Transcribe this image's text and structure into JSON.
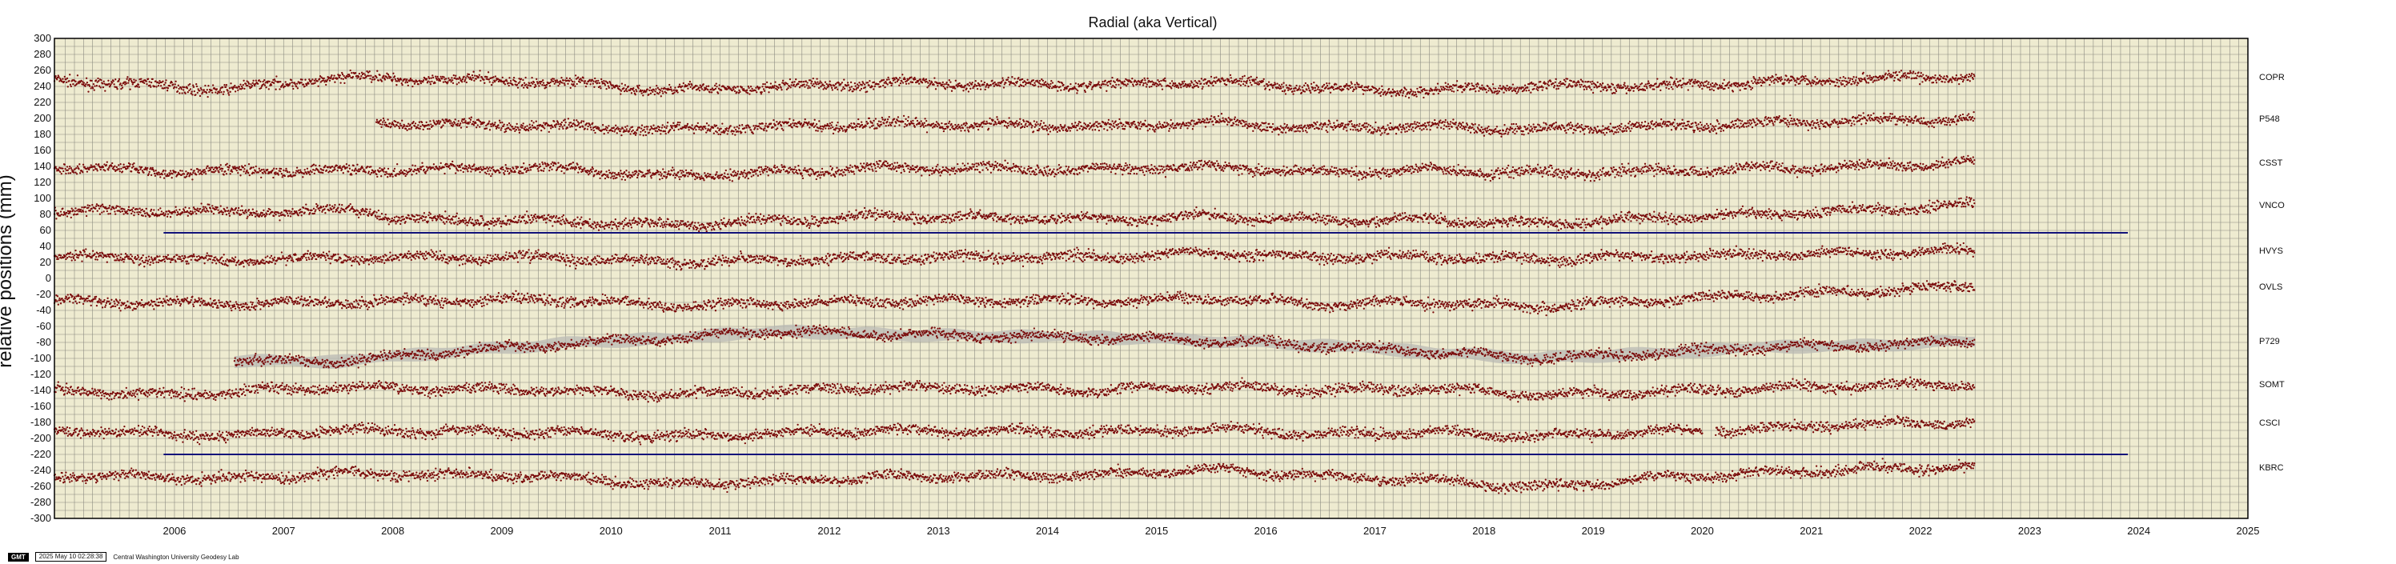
{
  "colors": {
    "background": "#eeebd0",
    "grid": "#8a8a80",
    "points": "#7a0b0b",
    "error_band": "#b9b9b4",
    "highlight_line": "#12137a"
  },
  "footer": {
    "logo": "GMT",
    "timestamp": "2025 May 10 02:28:38",
    "credit": "Central Washington University Geodesy Lab"
  },
  "chart_data": {
    "type": "scatter",
    "title": "Radial (aka Vertical)",
    "xlabel": "",
    "ylabel": "relative positions (mm)",
    "xlim": [
      2005.4,
      2025.5
    ],
    "ylim": [
      -300,
      300
    ],
    "grid": true,
    "x_ticks": [
      "2006",
      "2007",
      "2008",
      "2009",
      "2010",
      "2011",
      "2012",
      "2013",
      "2014",
      "2015",
      "2016",
      "2017",
      "2018",
      "2019",
      "2020",
      "2021",
      "2022",
      "2023",
      "2024",
      "2025"
    ],
    "y_ticks": [
      300,
      280,
      260,
      240,
      220,
      200,
      180,
      160,
      140,
      120,
      100,
      80,
      60,
      40,
      20,
      0,
      -20,
      -40,
      -60,
      -80,
      -100,
      -120,
      -140,
      -160,
      -180,
      -200,
      -220,
      -240,
      -260,
      -280,
      -300
    ],
    "series": [
      {
        "name": "COPR",
        "start": 2005.4,
        "end": 2023.0,
        "trend": [
          [
            2005.4,
            248
          ],
          [
            2007.0,
            236
          ],
          [
            2008.0,
            251
          ],
          [
            2010.0,
            246
          ],
          [
            2011.0,
            235
          ],
          [
            2013.0,
            244
          ],
          [
            2015.0,
            242
          ],
          [
            2016.0,
            246
          ],
          [
            2017.0,
            238
          ],
          [
            2018.0,
            234
          ],
          [
            2019.0,
            241
          ],
          [
            2020.0,
            240
          ],
          [
            2021.0,
            245
          ],
          [
            2022.0,
            250
          ],
          [
            2023.0,
            252
          ]
        ]
      },
      {
        "name": "P548",
        "start": 2008.35,
        "end": 2023.0,
        "trend": [
          [
            2008.35,
            195
          ],
          [
            2010.0,
            190
          ],
          [
            2011.0,
            186
          ],
          [
            2013.0,
            193
          ],
          [
            2015.0,
            190
          ],
          [
            2016.0,
            195
          ],
          [
            2017.0,
            188
          ],
          [
            2018.0,
            190
          ],
          [
            2019.0,
            186
          ],
          [
            2020.0,
            190
          ],
          [
            2021.0,
            194
          ],
          [
            2022.0,
            197
          ],
          [
            2023.0,
            200
          ]
        ]
      },
      {
        "name": "CSST",
        "start": 2005.4,
        "end": 2023.0,
        "trend": [
          [
            2005.4,
            140
          ],
          [
            2006.5,
            133
          ],
          [
            2008.0,
            135
          ],
          [
            2010.0,
            138
          ],
          [
            2011.0,
            128
          ],
          [
            2013.0,
            138
          ],
          [
            2015.0,
            136
          ],
          [
            2016.0,
            140
          ],
          [
            2017.0,
            132
          ],
          [
            2018.0,
            135
          ],
          [
            2019.0,
            132
          ],
          [
            2020.0,
            134
          ],
          [
            2021.0,
            137
          ],
          [
            2022.0,
            140
          ],
          [
            2023.0,
            145
          ]
        ]
      },
      {
        "name": "VNCO",
        "start": 2005.4,
        "end": 2023.0,
        "trend": [
          [
            2005.4,
            85
          ],
          [
            2007.0,
            83
          ],
          [
            2008.3,
            85
          ],
          [
            2008.5,
            74
          ],
          [
            2010.0,
            72
          ],
          [
            2011.0,
            66
          ],
          [
            2013.0,
            78
          ],
          [
            2015.0,
            74
          ],
          [
            2016.0,
            78
          ],
          [
            2017.0,
            72
          ],
          [
            2018.0,
            74
          ],
          [
            2019.0,
            68
          ],
          [
            2020.0,
            75
          ],
          [
            2021.0,
            80
          ],
          [
            2022.0,
            85
          ],
          [
            2023.0,
            92
          ]
        ]
      },
      {
        "name": "HVYS",
        "start": 2005.4,
        "end": 2023.0,
        "trend": [
          [
            2005.4,
            28
          ],
          [
            2007.0,
            22
          ],
          [
            2008.0,
            26
          ],
          [
            2010.0,
            26
          ],
          [
            2011.0,
            20
          ],
          [
            2013.0,
            26
          ],
          [
            2015.0,
            27
          ],
          [
            2016.0,
            32
          ],
          [
            2017.0,
            26
          ],
          [
            2018.0,
            27
          ],
          [
            2019.0,
            24
          ],
          [
            2020.0,
            27
          ],
          [
            2021.0,
            30
          ],
          [
            2022.0,
            32
          ],
          [
            2023.0,
            35
          ]
        ]
      },
      {
        "name": "OVLS",
        "start": 2005.4,
        "end": 2023.0,
        "trend": [
          [
            2005.4,
            -28
          ],
          [
            2007.0,
            -32
          ],
          [
            2008.0,
            -30
          ],
          [
            2010.0,
            -26
          ],
          [
            2011.0,
            -34
          ],
          [
            2013.0,
            -28
          ],
          [
            2015.0,
            -28
          ],
          [
            2016.0,
            -25
          ],
          [
            2017.0,
            -32
          ],
          [
            2018.0,
            -30
          ],
          [
            2019.0,
            -36
          ],
          [
            2020.0,
            -28
          ],
          [
            2021.0,
            -22
          ],
          [
            2022.0,
            -16
          ],
          [
            2023.0,
            -10
          ]
        ]
      },
      {
        "name": "P729",
        "start": 2007.05,
        "end": 2023.0,
        "band": 7,
        "trend": [
          [
            2007.05,
            -103
          ],
          [
            2008.0,
            -104
          ],
          [
            2009.0,
            -92
          ],
          [
            2010.0,
            -82
          ],
          [
            2011.0,
            -75
          ],
          [
            2012.0,
            -66
          ],
          [
            2013.0,
            -70
          ],
          [
            2014.0,
            -72
          ],
          [
            2015.0,
            -74
          ],
          [
            2016.0,
            -78
          ],
          [
            2017.0,
            -84
          ],
          [
            2018.0,
            -92
          ],
          [
            2019.0,
            -100
          ],
          [
            2020.0,
            -94
          ],
          [
            2021.0,
            -86
          ],
          [
            2022.0,
            -84
          ],
          [
            2023.0,
            -78
          ]
        ]
      },
      {
        "name": "SOMT",
        "start": 2005.4,
        "end": 2023.0,
        "trend": [
          [
            2005.4,
            -140
          ],
          [
            2006.5,
            -145
          ],
          [
            2008.0,
            -136
          ],
          [
            2010.0,
            -140
          ],
          [
            2011.0,
            -146
          ],
          [
            2013.0,
            -136
          ],
          [
            2015.0,
            -140
          ],
          [
            2016.0,
            -135
          ],
          [
            2017.0,
            -140
          ],
          [
            2018.0,
            -138
          ],
          [
            2019.0,
            -146
          ],
          [
            2020.0,
            -142
          ],
          [
            2021.0,
            -138
          ],
          [
            2022.0,
            -134
          ],
          [
            2023.0,
            -132
          ]
        ]
      },
      {
        "name": "CSCI",
        "start": 2005.4,
        "end": 2023.0,
        "gap": [
          2020.5,
          2020.62
        ],
        "trend": [
          [
            2005.4,
            -190
          ],
          [
            2007.0,
            -196
          ],
          [
            2008.0,
            -190
          ],
          [
            2010.0,
            -192
          ],
          [
            2011.0,
            -198
          ],
          [
            2013.0,
            -190
          ],
          [
            2015.0,
            -192
          ],
          [
            2016.0,
            -188
          ],
          [
            2017.0,
            -195
          ],
          [
            2018.0,
            -192
          ],
          [
            2019.0,
            -198
          ],
          [
            2020.0,
            -192
          ],
          [
            2021.0,
            -188
          ],
          [
            2022.0,
            -182
          ],
          [
            2023.0,
            -180
          ]
        ]
      },
      {
        "name": "KBRC",
        "start": 2005.4,
        "end": 2023.0,
        "trend": [
          [
            2005.4,
            -246
          ],
          [
            2007.0,
            -250
          ],
          [
            2008.0,
            -244
          ],
          [
            2010.0,
            -248
          ],
          [
            2011.0,
            -258
          ],
          [
            2013.0,
            -248
          ],
          [
            2015.0,
            -246
          ],
          [
            2016.0,
            -238
          ],
          [
            2017.0,
            -248
          ],
          [
            2018.0,
            -252
          ],
          [
            2019.0,
            -262
          ],
          [
            2020.0,
            -250
          ],
          [
            2021.0,
            -244
          ],
          [
            2022.0,
            -238
          ],
          [
            2023.0,
            -236
          ]
        ]
      }
    ],
    "reference_lines": [
      {
        "y": 57,
        "x_start": 2006.4,
        "x_end": 2024.4
      },
      {
        "y": -220,
        "x_start": 2006.4,
        "x_end": 2024.4
      }
    ]
  }
}
